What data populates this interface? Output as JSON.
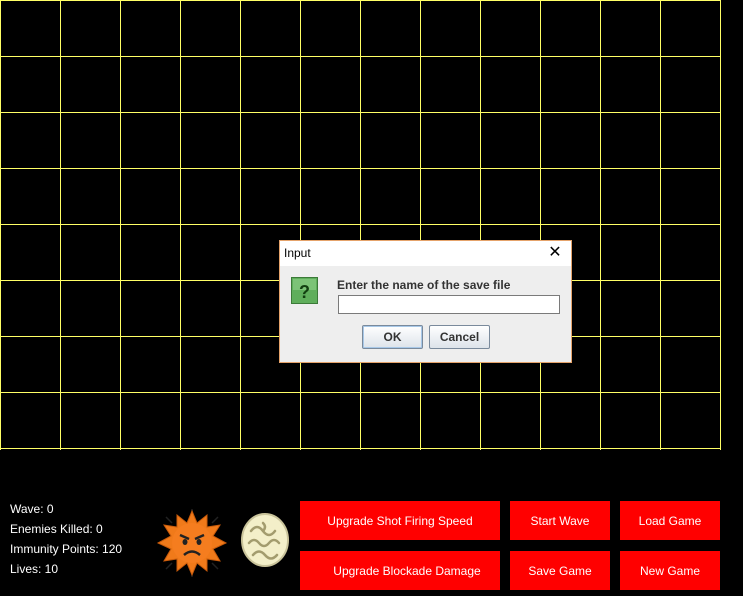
{
  "colors": {
    "grid_line": "#ffff66",
    "background": "#000000",
    "button": "#ff0000",
    "button_text": "#ffffff"
  },
  "grid": {
    "columns": 12,
    "rows": 8
  },
  "stats": {
    "wave": "Wave: 0",
    "enemies_killed": "Enemies Killed: 0",
    "immunity_points": "Immunity Points: 120",
    "lives": "Lives: 10"
  },
  "icons": {
    "enemy": "virus-icon",
    "tower": "white-blood-cell-icon"
  },
  "buttons": {
    "upgrade_fire_speed": "Upgrade Shot Firing Speed",
    "upgrade_blockade": "Upgrade Blockade Damage",
    "start_wave": "Start Wave",
    "save_game": "Save Game",
    "load_game": "Load Game",
    "new_game": "New Game"
  },
  "dialog": {
    "title": "Input",
    "prompt": "Enter the name of the save file",
    "input_value": "",
    "ok": "OK",
    "cancel": "Cancel"
  }
}
